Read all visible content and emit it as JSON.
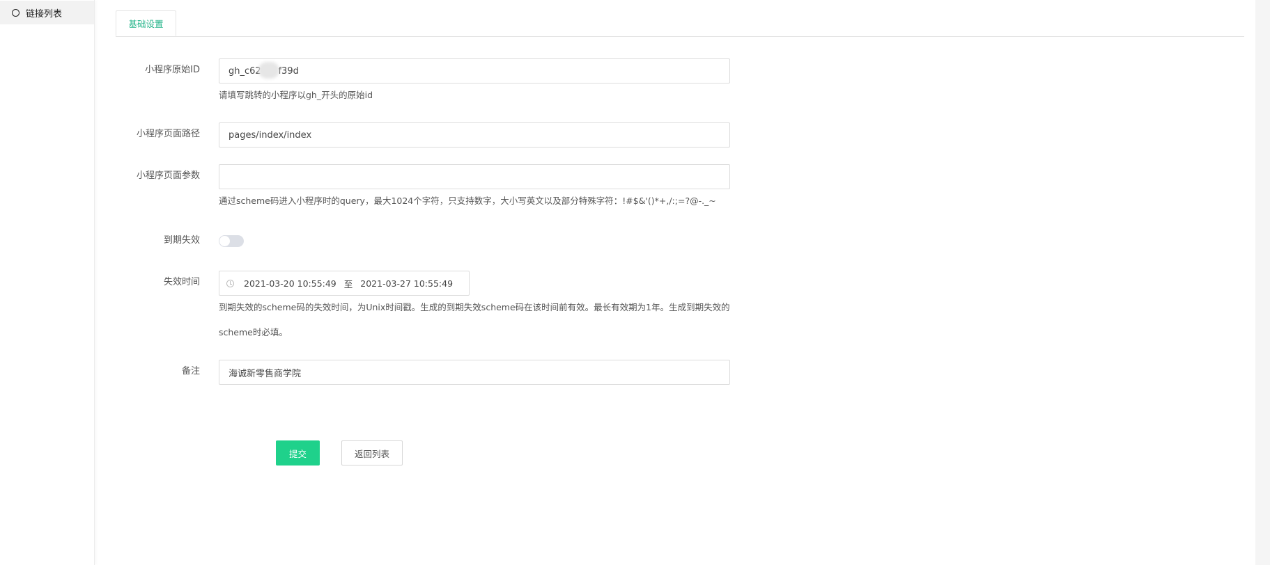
{
  "sidebar": {
    "items": [
      {
        "label": "链接列表",
        "icon": "circle-icon"
      }
    ]
  },
  "tabs": [
    {
      "label": "基础设置",
      "active": true
    }
  ],
  "form": {
    "appid": {
      "label": "小程序原始ID",
      "value": "gh_c62      f39d",
      "help": "请填写跳转的小程序以gh_开头的原始id"
    },
    "path": {
      "label": "小程序页面路径",
      "value": "pages/index/index"
    },
    "query": {
      "label": "小程序页面参数",
      "value": "",
      "help": "通过scheme码进入小程序时的query，最大1024个字符，只支持数字，大小写英文以及部分特殊字符：!#$&'()*+,/:;=?@-._~"
    },
    "expire": {
      "label": "到期失效",
      "enabled": false
    },
    "expire_time": {
      "label": "失效时间",
      "start": "2021-03-20 10:55:49",
      "separator": "至",
      "end": "2021-03-27 10:55:49",
      "help_line1": "到期失效的scheme码的失效时间，为Unix时间戳。生成的到期失效scheme码在该时间前有效。最长有效期为1年。生成到期失效的",
      "help_line2": "scheme时必填。"
    },
    "remark": {
      "label": "备注",
      "value": "海诚新零售商学院"
    }
  },
  "buttons": {
    "submit": "提交",
    "back": "返回列表"
  },
  "colors": {
    "accent": "#27b58b",
    "submit_bg": "#1fd18b",
    "toggle_off": "#dcdfe6"
  }
}
